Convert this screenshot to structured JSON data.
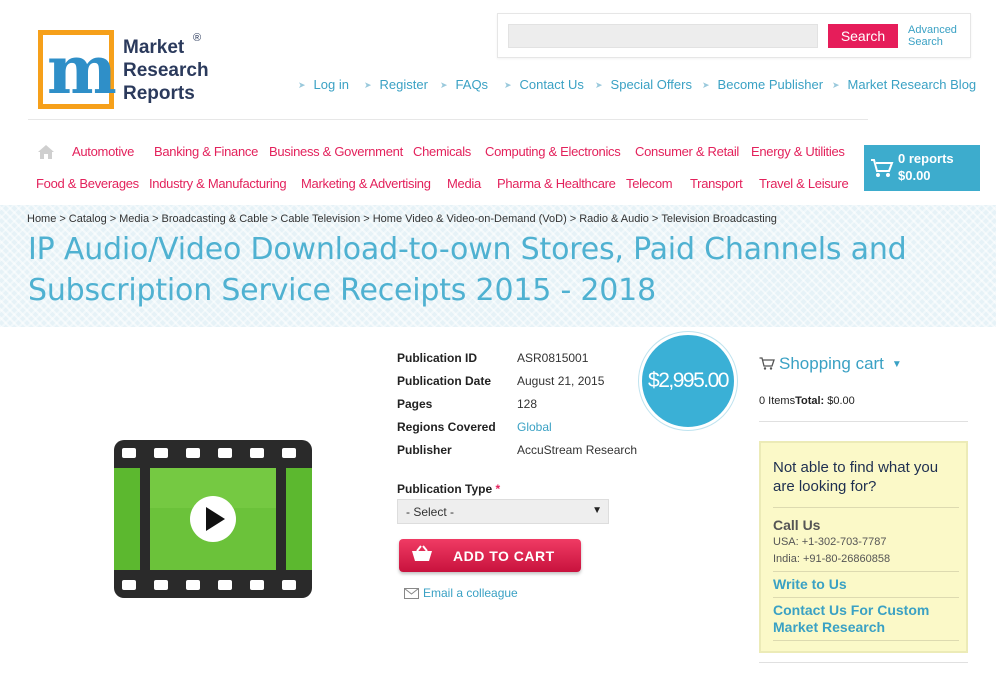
{
  "logo": {
    "line1": "Market",
    "line2": "Research",
    "line3": "Reports",
    "reg": "®"
  },
  "search": {
    "placeholder": "",
    "button": "Search",
    "advanced_line1": "Advanced",
    "advanced_line2": "Search"
  },
  "top_nav": [
    "Log in",
    "Register",
    "FAQs",
    "Contact Us",
    "Special Offers",
    "Become Publisher",
    "Market Research Blog"
  ],
  "categories_row1": [
    "Automotive",
    "Banking & Finance",
    "Business & Government",
    "Chemicals",
    "Computing & Electronics",
    "Consumer & Retail",
    "Energy & Utilities"
  ],
  "categories_row2": [
    "Food & Beverages",
    "Industry & Manufacturing",
    "Marketing & Advertising",
    "Media",
    "Pharma & Healthcare",
    "Telecom",
    "Transport",
    "Travel & Leisure"
  ],
  "cart": {
    "reports": "0 reports",
    "total": "$0.00"
  },
  "breadcrumb": [
    "Home",
    "Catalog",
    "Media",
    "Broadcasting & Cable",
    "Cable Television",
    "Home Video & Video-on-Demand (VoD)",
    "Radio & Audio",
    "Television Broadcasting"
  ],
  "title": {
    "line1": "IP Audio/Video Download-to-own Stores, Paid Channels and",
    "line2": "Subscription Service Receipts 2015 - 2018"
  },
  "details": [
    {
      "label": "Publication ID",
      "value": "ASR0815001"
    },
    {
      "label": "Publication Date",
      "value": "August 21, 2015"
    },
    {
      "label": "Pages",
      "value": "128"
    },
    {
      "label": "Regions Covered",
      "value": "Global"
    },
    {
      "label": "Publisher",
      "value": "AccuStream Research"
    }
  ],
  "price": "$2,995.00",
  "publication_type": {
    "label": "Publication Type",
    "required": "*",
    "selected": "- Select -"
  },
  "add_to_cart": "ADD TO CART",
  "email_colleague": "Email a colleague",
  "shopping_cart": {
    "title": "Shopping cart",
    "items": "0 Items",
    "total_label": "Total:",
    "total_value": " $0.00"
  },
  "help": {
    "question": "Not able to find what you are looking for?",
    "call_us": "Call Us",
    "usa": "USA: +1-302-703-7787",
    "india": "India: +91-80-26860858",
    "write": "Write to Us",
    "custom": "Contact Us For Custom Market Research"
  },
  "colors": {
    "accent_blue": "#3aa1c4",
    "accent_pink": "#e3225c",
    "cart_bg": "#3daccd",
    "price_bg": "#3ab0d6",
    "help_bg": "#fbf9c8"
  }
}
